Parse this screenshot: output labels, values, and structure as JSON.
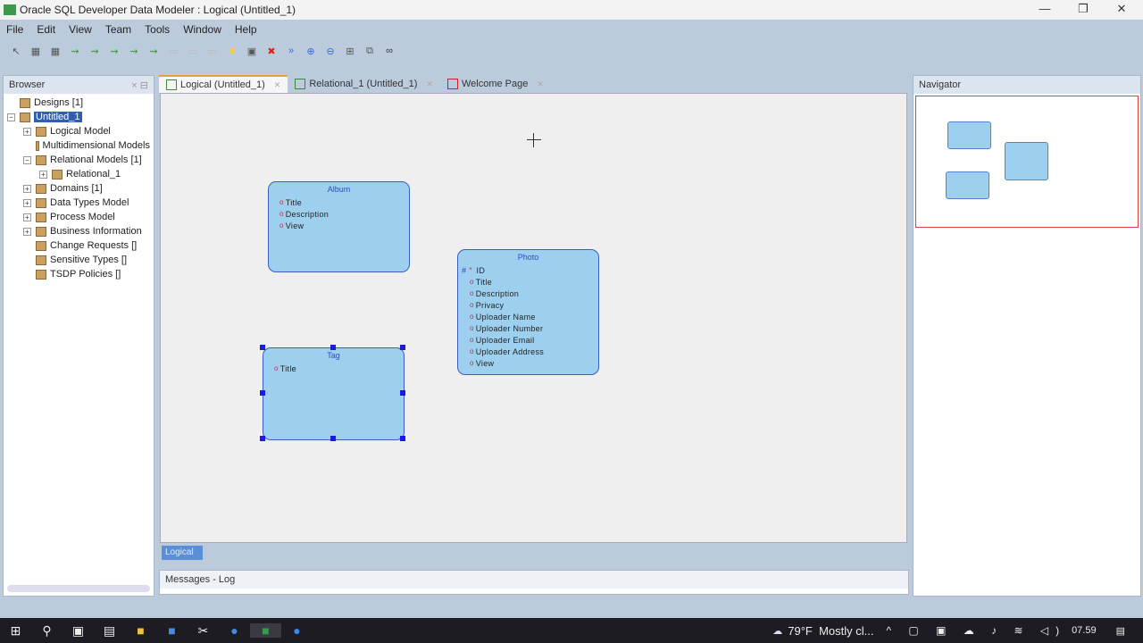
{
  "window": {
    "title": "Oracle SQL Developer Data Modeler : Logical (Untitled_1)",
    "minimize": "—",
    "restore": "❐",
    "close": "✕"
  },
  "menu": [
    "File",
    "Edit",
    "View",
    "Team",
    "Tools",
    "Window",
    "Help"
  ],
  "toolbar_icons": [
    "select-pointer",
    "new-entity",
    "new-view",
    "new-relation-1-1",
    "new-relation-1-n",
    "new-relation-n-1",
    "new-relation-m-n",
    "new-inheritance",
    "arc-disabled-1",
    "arc-disabled-2",
    "arc-disabled-3",
    "new-note",
    "picture",
    "delete",
    "engineer-to-relational",
    "zoom-in",
    "zoom-out",
    "fit-screen",
    "normal-size",
    "find"
  ],
  "browser": {
    "title": "Browser",
    "items": [
      {
        "label": "Designs [1]",
        "level": 0,
        "exp": ""
      },
      {
        "label": "Untitled_1",
        "level": 0,
        "exp": "−",
        "selected": true
      },
      {
        "label": "Logical Model",
        "level": 1,
        "exp": "+"
      },
      {
        "label": "Multidimensional Models",
        "level": 1,
        "exp": ""
      },
      {
        "label": "Relational Models [1]",
        "level": 1,
        "exp": "−"
      },
      {
        "label": "Relational_1",
        "level": 2,
        "exp": "+"
      },
      {
        "label": "Domains [1]",
        "level": 1,
        "exp": "+"
      },
      {
        "label": "Data Types Model",
        "level": 1,
        "exp": "+"
      },
      {
        "label": "Process Model",
        "level": 1,
        "exp": "+"
      },
      {
        "label": "Business Information",
        "level": 1,
        "exp": "+"
      },
      {
        "label": "Change Requests []",
        "level": 1,
        "exp": ""
      },
      {
        "label": "Sensitive Types []",
        "level": 1,
        "exp": ""
      },
      {
        "label": "TSDP Policies []",
        "level": 1,
        "exp": ""
      }
    ]
  },
  "tabs": [
    {
      "label": "Logical (Untitled_1)",
      "active": true
    },
    {
      "label": "Relational_1 (Untitled_1)"
    },
    {
      "label": "Welcome Page"
    }
  ],
  "entities": {
    "album": {
      "name": "Album",
      "attrs": [
        "Title",
        "Description",
        "View"
      ]
    },
    "photo": {
      "name": "Photo",
      "pk": "ID",
      "attrs": [
        "Title",
        "Description",
        "Privacy",
        "Uploader Name",
        "Uploader Number",
        "Uploader Email",
        "Uploader Address",
        "View"
      ]
    },
    "tag": {
      "name": "Tag",
      "attrs": [
        "Title"
      ],
      "selected": true
    }
  },
  "bottom_tab": "Logical",
  "messages": {
    "title": "Messages - Log"
  },
  "navigator": {
    "title": "Navigator"
  },
  "taskbar": {
    "weather": "79°F  Mostly cl...",
    "time": "07.59"
  },
  "colors": {
    "entity_fill": "#9dd0ee",
    "entity_border": "#3a5fc0",
    "selection": "#1a1ae0"
  }
}
